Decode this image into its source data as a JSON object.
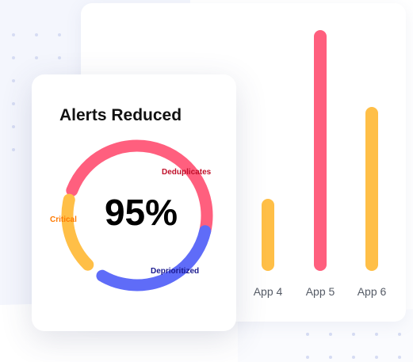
{
  "colors": {
    "red": "#ff5f7e",
    "yellow": "#ffbf47",
    "blue": "#5f6cf8",
    "dedupe_label": "#c0102a",
    "critical_label": "#ff7a00",
    "deprio_label": "#1a1a8f"
  },
  "bar_chart": {
    "categories": [
      "App 4",
      "App 5",
      "App 6"
    ],
    "values": [
      30,
      100,
      68
    ],
    "colors": [
      "#ffbf47",
      "#ff5f7e",
      "#ffbf47"
    ]
  },
  "alerts": {
    "title": "Alerts Reduced",
    "percent": "95%",
    "segments": [
      {
        "label": "Deduplicates",
        "share": 0.4
      },
      {
        "label": "Deprioritized",
        "share": 0.4
      },
      {
        "label": "Critical",
        "share": 0.2
      }
    ]
  }
}
